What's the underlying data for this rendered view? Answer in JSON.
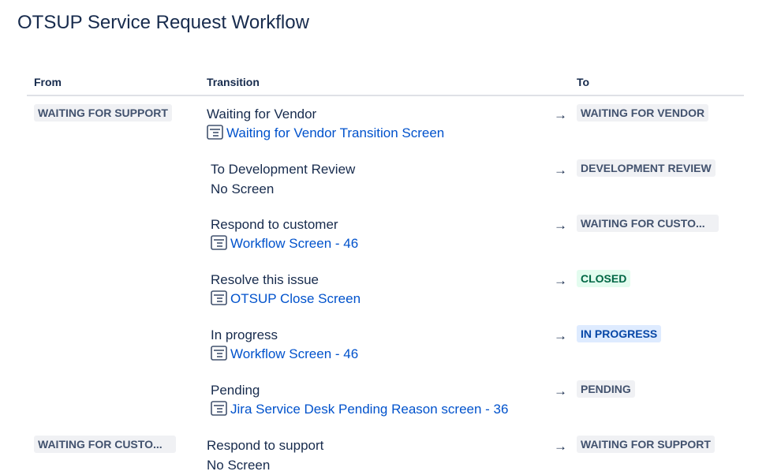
{
  "page": {
    "title": "OTSUP Service Request Workflow"
  },
  "table": {
    "headers": {
      "from": "From",
      "transition": "Transition",
      "to": "To"
    },
    "groups": [
      {
        "from": "WAITING FOR SUPPORT",
        "transitions": [
          {
            "name": "Waiting for Vendor",
            "screen": "Waiting for Vendor Transition Screen",
            "screen_icon": "screen-icon",
            "to": "WAITING FOR VENDOR",
            "to_color": "#42526e"
          },
          {
            "name": "To Development Review",
            "screen": "No Screen",
            "to": "DEVELOPMENT REVIEW",
            "to_color": "#42526e"
          },
          {
            "name": "Respond to customer",
            "screen": "Workflow Screen - 46",
            "screen_icon": "screen-icon",
            "to": "WAITING FOR CUSTO...",
            "to_color": "#42526e"
          },
          {
            "name": "Resolve this issue",
            "screen": "OTSUP Close Screen",
            "screen_icon": "screen-icon",
            "to": "CLOSED",
            "to_color": "#006644"
          },
          {
            "name": "In progress",
            "screen": "Workflow Screen - 46",
            "screen_icon": "screen-icon",
            "to": "IN PROGRESS",
            "to_color": "#0747a6"
          },
          {
            "name": "Pending",
            "screen": "Jira Service Desk Pending Reason screen - 36",
            "screen_icon": "screen-icon",
            "to": "PENDING",
            "to_color": "#42526e"
          }
        ]
      },
      {
        "from": "WAITING FOR CUSTO...",
        "transitions": [
          {
            "name": "Respond to support",
            "screen": "No Screen",
            "to": "WAITING FOR SUPPORT",
            "to_color": "#42526e"
          }
        ]
      }
    ],
    "arrow": "→"
  },
  "colors": {
    "link": "#0052cc",
    "text": "#172b4d",
    "lozenge_default_bg": "#f0f1f4",
    "lozenge_green_bg": "#e3fcef",
    "lozenge_blue_bg": "#deebff"
  }
}
